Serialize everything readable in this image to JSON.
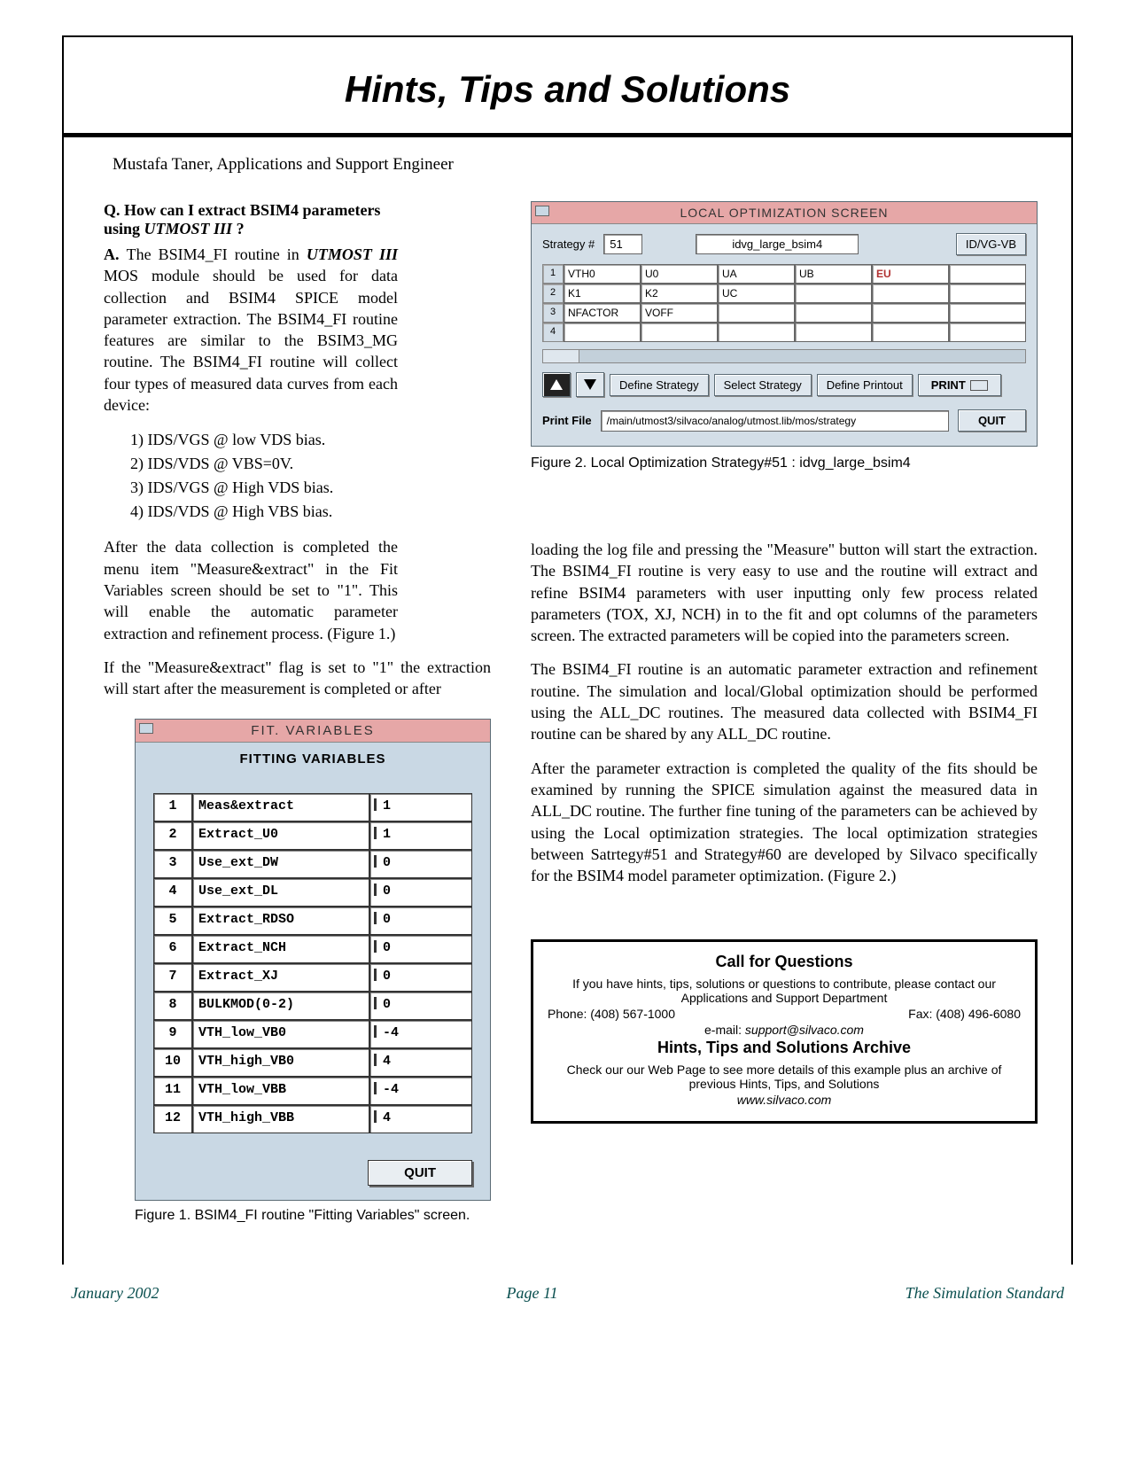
{
  "header": {
    "title": "Hints, Tips and Solutions"
  },
  "author": "Mustafa Taner, Applications and Support Engineer",
  "question": "Q. How can I extract BSIM4 parameters using UTMOST III ?",
  "answer_p1_prefix": "A. ",
  "answer_p1": "The BSIM4_FI routine in UTMOST III MOS module should be used for data collection and BSIM4 SPICE model parameter extraction. The BSIM4_FI routine features are similar to the BSIM3_MG routine. The BSIM4_FI routine will collect four types of measured data curves from each device:",
  "measure_list": [
    "1) IDS/VGS @ low VDS bias.",
    "2) IDS/VDS @ VBS=0V.",
    "3) IDS/VGS @ High VDS bias.",
    "4) IDS/VDS @ High VBS bias."
  ],
  "para_after_list": "After the data collection is completed the menu item \"Measure&extract\" in the Fit Variables screen should be set to \"1\". This will enable the automatic parameter extraction and refinement process. (Figure 1.)",
  "para_full_width": "If the \"Measure&extract\" flag is set to \"1\" the extraction will start after the measurement is completed or after",
  "right_p1": "loading the log file and pressing the \"Measure\" button will start the extraction. The BSIM4_FI routine is very easy to use and the routine will extract and refine BSIM4 parameters with user inputting only few process related parameters (TOX, XJ, NCH) in to the fit and opt columns of the parameters screen. The extracted parameters will be copied into the parameters screen.",
  "right_p2": "The BSIM4_FI routine is an automatic parameter extraction and refinement routine. The simulation and local/Global optimization should be performed using the ALL_DC routines. The measured data collected with BSIM4_FI routine can be shared by any ALL_DC routine.",
  "right_p3": "After the parameter extraction is completed the quality of the fits should be examined by running the SPICE simulation against the measured data in ALL_DC routine. The further fine tuning of the parameters can be achieved by using the Local optimization strategies. The local optimization strategies between Satrtegy#51 and Strategy#60 are developed by Silvaco specifically for the BSIM4 model parameter optimization. (Figure 2.)",
  "fig1": {
    "win_title": "FIT. VARIABLES",
    "sub_title": "FITTING VARIABLES",
    "rows": [
      {
        "n": "1",
        "name": "Meas&extract",
        "val": "1"
      },
      {
        "n": "2",
        "name": "Extract_U0",
        "val": "1"
      },
      {
        "n": "3",
        "name": "Use_ext_DW",
        "val": "0"
      },
      {
        "n": "4",
        "name": "Use_ext_DL",
        "val": "0"
      },
      {
        "n": "5",
        "name": "Extract_RDSO",
        "val": "0"
      },
      {
        "n": "6",
        "name": "Extract_NCH",
        "val": "0"
      },
      {
        "n": "7",
        "name": "Extract_XJ",
        "val": "0"
      },
      {
        "n": "8",
        "name": "BULKMOD(0-2)",
        "val": "0"
      },
      {
        "n": "9",
        "name": "VTH_low_VB0",
        "val": "-4"
      },
      {
        "n": "10",
        "name": "VTH_high_VB0",
        "val": "4"
      },
      {
        "n": "11",
        "name": "VTH_low_VBB",
        "val": "-4"
      },
      {
        "n": "12",
        "name": "VTH_high_VBB",
        "val": "4"
      }
    ],
    "quit": "QUIT",
    "caption": "Figure 1. BSIM4_FI routine \"Fitting Variables\" screen."
  },
  "fig2": {
    "win_title": "LOCAL OPTIMIZATION SCREEN",
    "strategy_label": "Strategy #",
    "strategy_num": "51",
    "strategy_name": "idvg_large_bsim4",
    "plot_btn": "ID/VG-VB",
    "grid": {
      "row1": [
        "1",
        "VTH0",
        "U0",
        "UA",
        "UB",
        "EU",
        ""
      ],
      "row2": [
        "2",
        "K1",
        "K2",
        "UC",
        "",
        "",
        ""
      ],
      "row3": [
        "3",
        "NFACTOR",
        "VOFF",
        "",
        "",
        "",
        ""
      ],
      "row4": [
        "4",
        "",
        "",
        "",
        "",
        "",
        ""
      ]
    },
    "buttons": {
      "define_strategy": "Define Strategy",
      "select_strategy": "Select Strategy",
      "define_printout": "Define Printout",
      "print": "PRINT",
      "quit": "QUIT"
    },
    "print_file_label": "Print File",
    "print_file_path": "/main/utmost3/silvaco/analog/utmost.lib/mos/strategy",
    "caption": "Figure 2. Local Optimization Strategy#51 : idvg_large_bsim4"
  },
  "callbox": {
    "h1": "Call for Questions",
    "p1": "If you have hints, tips, solutions or questions to contribute, please contact our Applications and Support Department",
    "phone": "Phone: (408) 567-1000",
    "fax": "Fax: (408) 496-6080",
    "email_label": "e-mail: ",
    "email": "support@silvaco.com",
    "h2": "Hints, Tips and Solutions Archive",
    "p2": "Check our our Web Page to see more details of this example plus an archive of previous Hints, Tips, and Solutions",
    "url": "www.silvaco.com"
  },
  "footer": {
    "left": "January 2002",
    "center": "Page 11",
    "right": "The Simulation Standard"
  }
}
